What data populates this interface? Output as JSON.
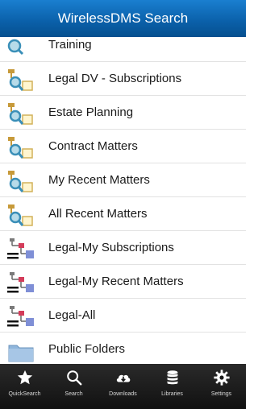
{
  "header": {
    "title": "WirelessDMS Search"
  },
  "list": {
    "items": [
      {
        "label": "Training",
        "icon": "search-doc-icon"
      },
      {
        "label": "Legal DV - Subscriptions",
        "icon": "search-folder-icon"
      },
      {
        "label": "Estate Planning",
        "icon": "search-folder-icon"
      },
      {
        "label": "Contract Matters",
        "icon": "search-folder-icon"
      },
      {
        "label": "My Recent Matters",
        "icon": "search-folder-icon"
      },
      {
        "label": "All Recent Matters",
        "icon": "search-folder-icon"
      },
      {
        "label": "Legal-My Subscriptions",
        "icon": "tree-icon"
      },
      {
        "label": "Legal-My Recent Matters",
        "icon": "tree-icon"
      },
      {
        "label": "Legal-All",
        "icon": "tree-icon"
      },
      {
        "label": "Public Folders",
        "icon": "folder-icon"
      }
    ]
  },
  "toolbar": {
    "items": [
      {
        "label": "QuickSearch",
        "icon": "star-icon"
      },
      {
        "label": "Search",
        "icon": "search-icon"
      },
      {
        "label": "Downloads",
        "icon": "cloud-download-icon"
      },
      {
        "label": "Libraries",
        "icon": "database-icon"
      },
      {
        "label": "Settings",
        "icon": "gear-icon"
      }
    ]
  },
  "colors": {
    "header_blue": "#0a5fa8",
    "toolbar_dark": "#1a1a1a"
  }
}
